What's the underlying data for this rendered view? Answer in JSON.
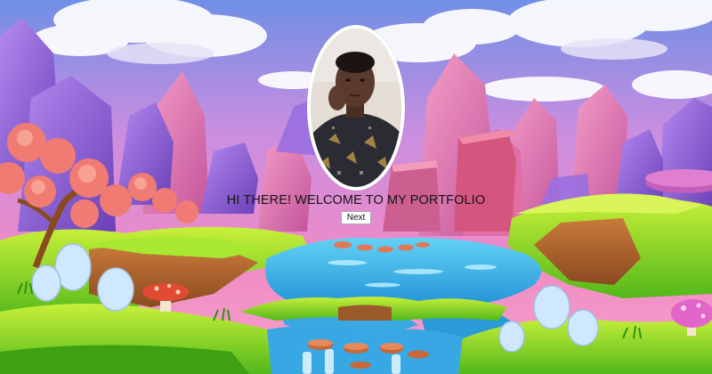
{
  "hero": {
    "headline": "HI THERE! WELCOME TO MY PORTFOLIO",
    "next_label": "Next"
  },
  "colors": {
    "sky_top": "#5b7ee0",
    "sky_mid": "#e684c9",
    "water": "#3fb4e6",
    "grass": "#7ed321",
    "rock_pink": "#e27ab4",
    "rock_purple": "#8c5fd0"
  }
}
